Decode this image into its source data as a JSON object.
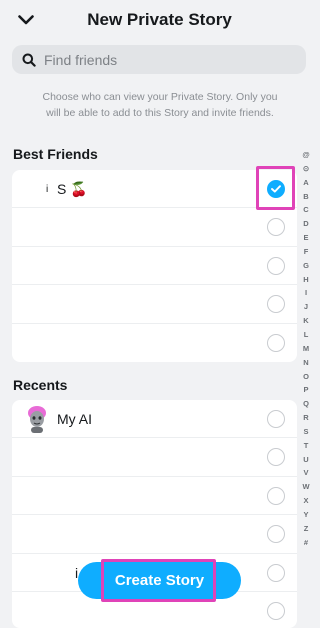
{
  "header": {
    "back_icon": "chevron-down-icon",
    "title": "New Private Story"
  },
  "search": {
    "placeholder": "Find friends",
    "value": "",
    "icon": "search-icon"
  },
  "description": "Choose who can view your Private Story. Only you will be able to add to this Story and invite friends.",
  "best_friends": {
    "title": "Best Friends",
    "rows": [
      {
        "prefix": "i",
        "label": "S 🍒",
        "checked": true
      },
      {
        "label": "",
        "checked": false
      },
      {
        "label": "",
        "checked": false
      },
      {
        "label": "",
        "checked": false
      },
      {
        "label": "",
        "checked": false
      }
    ]
  },
  "recents": {
    "title": "Recents",
    "rows": [
      {
        "label": "My AI",
        "checked": false,
        "avatar": "bitmoji-avatar"
      },
      {
        "label": "",
        "checked": false
      },
      {
        "label": "",
        "checked": false
      },
      {
        "label": "",
        "checked": false
      },
      {
        "label": "i",
        "checked": false
      },
      {
        "label": "",
        "checked": false
      }
    ]
  },
  "alpha_index": [
    "@",
    "⊙",
    "A",
    "B",
    "C",
    "D",
    "E",
    "F",
    "G",
    "H",
    "I",
    "J",
    "K",
    "L",
    "M",
    "N",
    "O",
    "P",
    "Q",
    "R",
    "S",
    "T",
    "U",
    "V",
    "W",
    "X",
    "Y",
    "Z",
    "#"
  ],
  "create_button": {
    "label": "Create Story"
  },
  "colors": {
    "accent": "#0fadff",
    "highlight": "#e043b8",
    "background": "#f1f2f4"
  }
}
